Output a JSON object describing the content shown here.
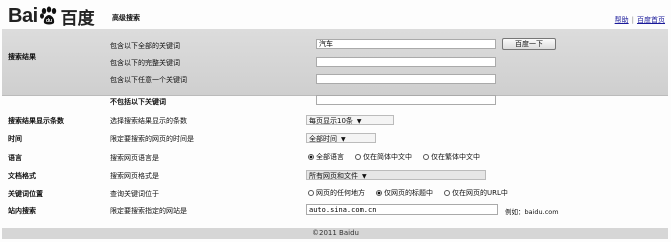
{
  "header": {
    "logo_text": "Bai",
    "logo_cn": "百度",
    "page_title": "高级搜索",
    "help_link": "帮助",
    "home_link": "百度首页"
  },
  "search_results": {
    "section_label": "搜索结果",
    "rows": [
      {
        "desc": "包含以下全部的关键词",
        "value": "汽车"
      },
      {
        "desc": "包含以下的完整关键词",
        "value": ""
      },
      {
        "desc": "包含以下任意一个关键词",
        "value": ""
      },
      {
        "desc": "不包括以下关键词",
        "value": ""
      }
    ],
    "button_label": "百度一下"
  },
  "settings": [
    {
      "label": "搜索结果显示条数",
      "desc": "选择搜索结果显示的条数",
      "control": "select",
      "value": "每页显示10条"
    },
    {
      "label": "时间",
      "desc": "限定要搜索的网页的时间是",
      "control": "select",
      "value": "全部时间"
    },
    {
      "label": "语言",
      "desc": "搜索网页语言是",
      "control": "radio",
      "options": [
        "全部语言",
        "仅在简体中文中",
        "仅在繁体中文中"
      ],
      "selected": 0
    },
    {
      "label": "文档格式",
      "desc": "搜索网页格式是",
      "control": "select",
      "value": "所有网页和文件"
    },
    {
      "label": "关键词位置",
      "desc": "查询关键词位于",
      "control": "radio",
      "options": [
        "网页的任何地方",
        "仅网页的标题中",
        "仅在网页的URL中"
      ],
      "selected": 1
    },
    {
      "label": "站内搜索",
      "desc": "限定要搜索指定的网站是",
      "control": "input",
      "value": "auto.sina.com.cn",
      "hint": "例如：baidu.com"
    }
  ],
  "footer": "©2011 Baidu",
  "icons": {
    "logo": "paw-icon",
    "dropdown": "dropdown-arrow-icon",
    "radio": "radio-icon"
  }
}
